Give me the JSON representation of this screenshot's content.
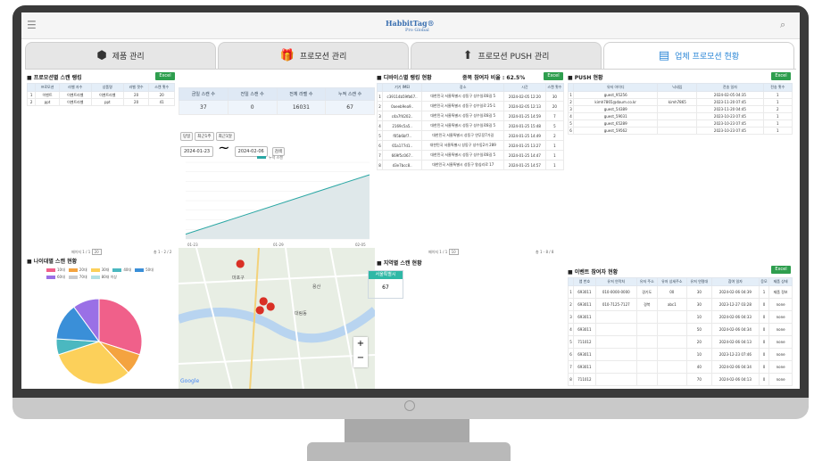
{
  "app": {
    "logo": "HabbitTag®",
    "logo_sub": "Pro Global"
  },
  "tabs": [
    {
      "label": "제품 관리",
      "icon": "cube-icon"
    },
    {
      "label": "프로모션 관리",
      "icon": "gift-icon"
    },
    {
      "label": "프로모션 PUSH 관리",
      "icon": "upload-icon"
    },
    {
      "label": "업체 프로모션 현황",
      "icon": "report-icon"
    }
  ],
  "promo_ranking": {
    "title": "프로모션별 스캔 랭킹",
    "excel": "Excel",
    "columns": [
      "프로모션",
      "라벨 자수",
      "상품명",
      "라벨 갯수",
      "스캔 횟수"
    ],
    "rows": [
      [
        "1",
        "이벤트",
        "이벤트라벨",
        "이벤트라벨",
        "20",
        "20"
      ],
      [
        "2",
        "ppt",
        "이벤트라벨",
        "ppt",
        "20",
        "41"
      ]
    ],
    "pager": "페이지 1 / 1",
    "page_size": "20",
    "range": "총 1 - 2 / 2"
  },
  "stats": {
    "columns": [
      "금일 스캔 수",
      "전일 스캔 수",
      "전체 라벨 수",
      "누적 스캔 수"
    ],
    "values": [
      "37",
      "0",
      "16031",
      "67"
    ]
  },
  "chart": {
    "buttons": [
      "당일",
      "최근1주",
      "최근1달"
    ],
    "date_from": "2024-01-23",
    "date_to": "2024-02-06",
    "search": "검색",
    "legend": "누적 스캔",
    "x_ticks": [
      "01-23",
      "01-29",
      "02-05"
    ]
  },
  "chart_data": {
    "type": "area",
    "x": [
      "01-23",
      "02-06"
    ],
    "y": [
      5,
      67
    ],
    "ylim": [
      0,
      80
    ]
  },
  "device_ranking": {
    "title": "디바이스별 랭킹 현황",
    "dup_rate_label": "중복 참여자 비율 : 62.5%",
    "excel": "Excel",
    "columns": [
      "기기 IMEI",
      "장소",
      "시간",
      "스캔 횟수"
    ],
    "rows": [
      [
        "1",
        "c39114b59fb67..",
        "대한민국 서울특별시 성동구 성수일로8길 5",
        "2024-02-05 12:20",
        "30"
      ],
      [
        "2",
        "0aeeb9ea9..",
        "대한민국 서울특별시 성동구 성수일로 25-1",
        "2024-02-05 12:13",
        "20"
      ],
      [
        "3",
        "c4a7f4202..",
        "대한민국 서울특별시 성동구 성수일로8길 5",
        "2024-01-25 14:59",
        "7"
      ],
      [
        "4",
        "2169c5a5..",
        "대한민국 서울특별시 성동구 성수일로8길 5",
        "2024-01-25 15:48",
        "5"
      ],
      [
        "5",
        "f05b6bf7..",
        "대한민국 서울특별시 성동구 연무장7가길",
        "2024-01-25 14:49",
        "2"
      ],
      [
        "6",
        "65a177d1..",
        "대한민국 서울특별시 성동구 성수동2가 289",
        "2024-01-25 13:27",
        "1"
      ],
      [
        "7",
        "669f5c067..",
        "대한민국 서울특별시 성동구 성수일로8길 5",
        "2024-01-25 14:47",
        "1"
      ],
      [
        "8",
        "d3e7bcc8..",
        "대한민국 서울특별시 성동구 왕십리로 17",
        "2024-01-25 14:57",
        "1"
      ]
    ],
    "pager": "페이지 1 / 1",
    "page_size": "10",
    "range": "총 1 - 8 / 8"
  },
  "push": {
    "title": "PUSH 현황",
    "excel": "Excel",
    "columns": [
      "유저 아이디",
      "닉네임",
      "전송 일자",
      "전송 횟수"
    ],
    "rows": [
      [
        "1",
        "guest_95256",
        "",
        "2024-02-05 04:35",
        "1"
      ],
      [
        "2",
        "kimh7865@daum.co.kr",
        "kimh7865",
        "2023-11-20 07:45",
        "1"
      ],
      [
        "3",
        "guest_54389",
        "",
        "2023-11-20 04:45",
        "2"
      ],
      [
        "4",
        "guest_59031",
        "",
        "2023-10-23 07:45",
        "1"
      ],
      [
        "5",
        "guest_65289",
        "",
        "2023-10-23 07:45",
        "1"
      ],
      [
        "6",
        "guest_59562",
        "",
        "2023-10-23 07:45",
        "1"
      ]
    ]
  },
  "age": {
    "title": "나이대별 스캔 현황",
    "legend": [
      "10대",
      "20대",
      "30대",
      "40대",
      "50대",
      "60대",
      "70대",
      "80대 이상"
    ]
  },
  "age_colors": [
    "#f0608a",
    "#f4a340",
    "#fcd05a",
    "#4bb8c0",
    "#3a8fd8",
    "#9a70e6",
    "#c9cbcf",
    "#b2e0e4"
  ],
  "age_values": [
    30,
    8,
    32,
    6,
    14,
    10,
    0,
    0
  ],
  "region": {
    "title": "지역별 스캔 현황",
    "header": "서울특별시",
    "value": "67"
  },
  "event": {
    "title": "이벤트 참여자 현황",
    "excel": "Excel",
    "columns": [
      "앱 번호",
      "유저 연락처",
      "유저 주소",
      "유저 상세주소",
      "유저 연령대",
      "참여 일자",
      "응모",
      "제품 상태"
    ],
    "rows": [
      [
        "1",
        "693011",
        "010-0000-0000",
        "경기도",
        "00",
        "30",
        "2024-02-06 04:39",
        "1",
        "제품 정보"
      ],
      [
        "2",
        "693011",
        "010-7125-7127",
        "경북",
        "abc1",
        "30",
        "2023-12-27 03:28",
        "0",
        "none"
      ],
      [
        "3",
        "693011",
        "",
        "",
        "",
        "10",
        "2024-02-06 04:33",
        "0",
        "none"
      ],
      [
        "4",
        "693011",
        "",
        "",
        "",
        "50",
        "2024-02-06 04:34",
        "0",
        "none"
      ],
      [
        "5",
        "711012",
        "",
        "",
        "",
        "20",
        "2024-02-06 04:13",
        "0",
        "none"
      ],
      [
        "6",
        "693011",
        "",
        "",
        "",
        "10",
        "2023-12-23 07:46",
        "0",
        "none"
      ],
      [
        "7",
        "693011",
        "",
        "",
        "",
        "40",
        "2024-02-06 04:34",
        "0",
        "none"
      ],
      [
        "8",
        "711012",
        "",
        "",
        "",
        "70",
        "2024-02-06 04:13",
        "0",
        "none"
      ]
    ]
  },
  "map": {
    "labels": [
      "대림동",
      "용산",
      "마포구"
    ],
    "attribution": "Google"
  }
}
